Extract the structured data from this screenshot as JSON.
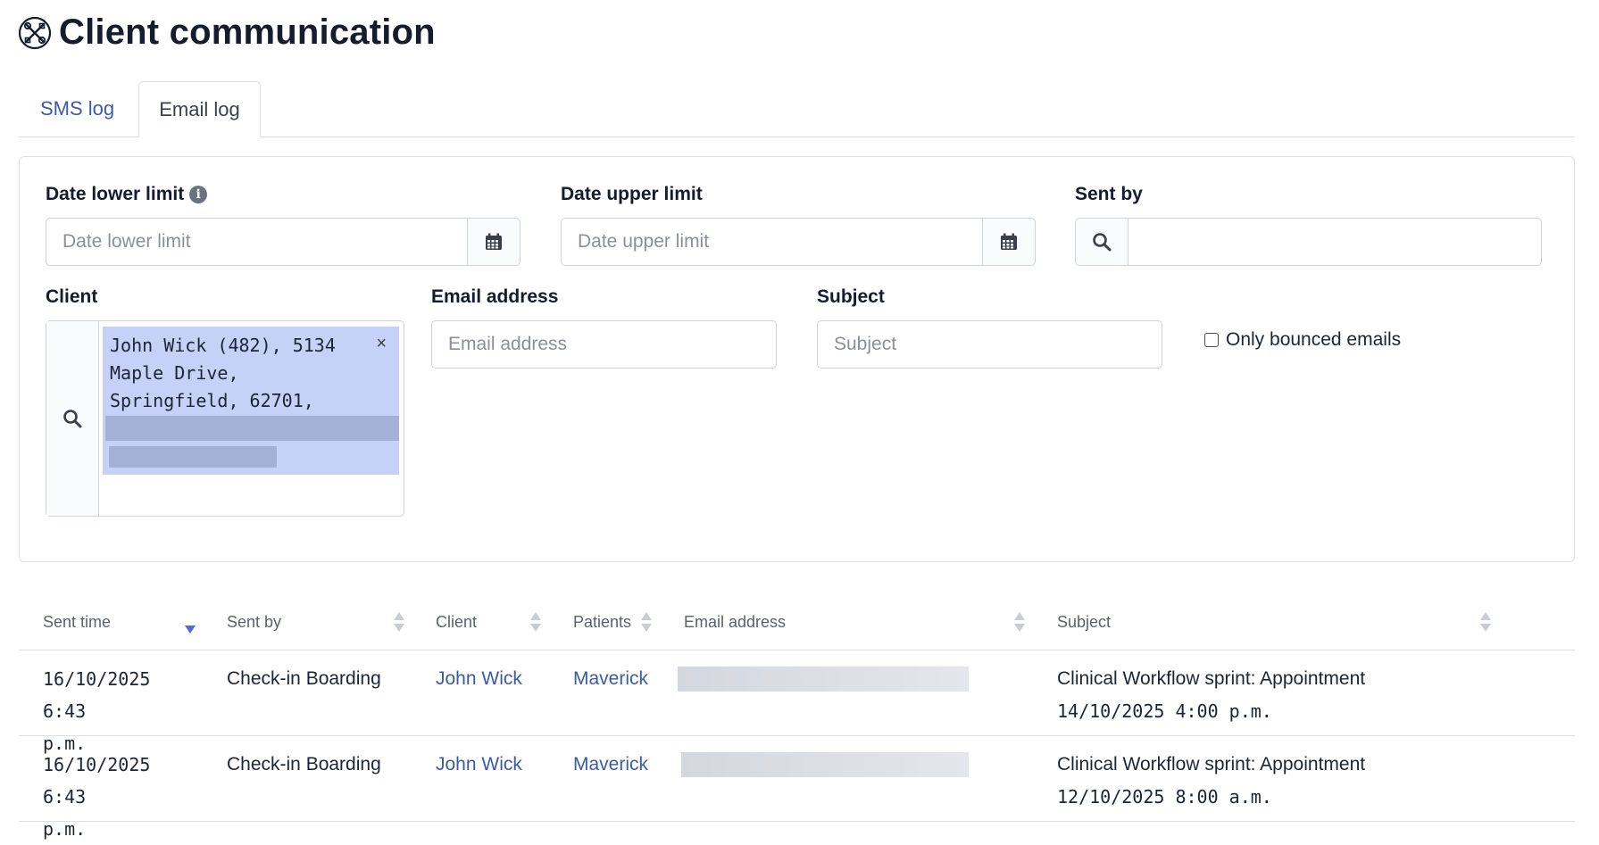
{
  "page": {
    "title": "Client communication"
  },
  "tabs": [
    {
      "label": "SMS log",
      "active": false
    },
    {
      "label": "Email log",
      "active": true
    }
  ],
  "filters": {
    "date_lower": {
      "label": "Date lower limit",
      "placeholder": "Date lower limit",
      "info_icon": "info-circle-icon"
    },
    "date_upper": {
      "label": "Date upper limit",
      "placeholder": "Date upper limit"
    },
    "sent_by": {
      "label": "Sent by",
      "value": ""
    },
    "client": {
      "label": "Client",
      "selected_chip": "John Wick (482), 5134 Maple Drive, Springfield, 62701,",
      "remove_symbol": "×"
    },
    "email_address": {
      "label": "Email address",
      "placeholder": "Email address"
    },
    "subject": {
      "label": "Subject",
      "placeholder": "Subject"
    },
    "only_bounced": {
      "label": "Only bounced emails",
      "checked": false
    }
  },
  "table": {
    "columns": [
      "Sent time",
      "Sent by",
      "Client",
      "Patients",
      "Email address",
      "Subject"
    ],
    "sort_column": "Sent time",
    "sort_direction": "desc",
    "rows": [
      {
        "sent_time_line1": "16/10/2025 6:43",
        "sent_time_line2": "p.m.",
        "sent_by": "Check-in Boarding",
        "client": "John Wick",
        "patients": "Maverick",
        "subject_line1": "Clinical Workflow sprint: Appointment",
        "subject_line2": "14/10/2025 4:00 p.m."
      },
      {
        "sent_time_line1": "16/10/2025 6:43",
        "sent_time_line2": "p.m.",
        "sent_by": "Check-in Boarding",
        "client": "John Wick",
        "patients": "Maverick",
        "subject_line1": "Clinical Workflow sprint: Appointment",
        "subject_line2": "12/10/2025 8:00 a.m."
      }
    ]
  },
  "colors": {
    "accent": "#3d5aa8",
    "chip_bg": "#c5d1f7",
    "sort_active": "#5668d6"
  }
}
